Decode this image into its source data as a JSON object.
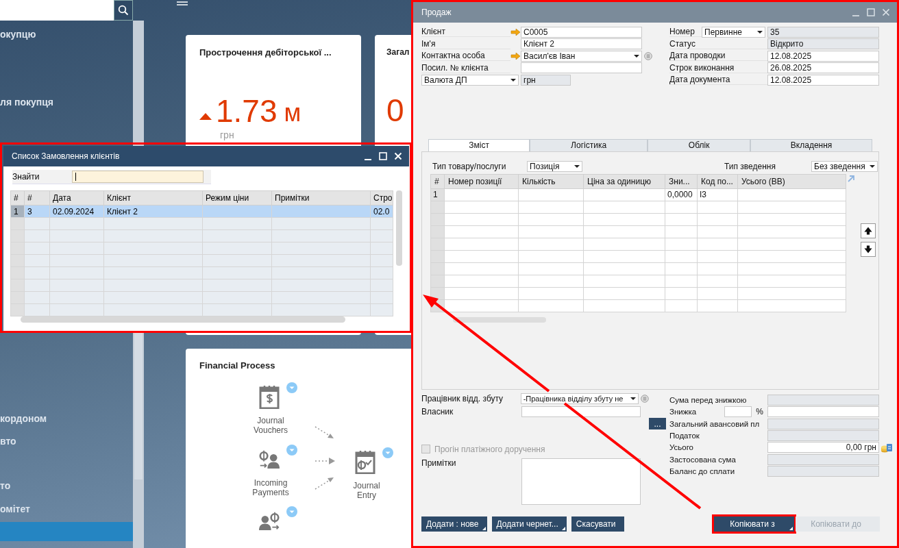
{
  "sidebar": {
    "items": [
      {
        "label": "окупцю",
        "selected": false
      },
      {
        "label": "ля покупця",
        "selected": false
      },
      {
        "label": "кордоном",
        "selected": false
      },
      {
        "label": "вто",
        "selected": false
      },
      {
        "label": "то",
        "selected": false
      },
      {
        "label": "омітет",
        "selected": false
      },
      {
        "selected": true
      }
    ]
  },
  "cards": [
    {
      "title": "Прострочення дебіторської ...",
      "value": "1.73",
      "unit": "м",
      "currency": "грн",
      "rising": true
    },
    {
      "title": "Загал",
      "value": "0"
    }
  ],
  "financial_process": {
    "title": "Financial Process",
    "nodes": [
      {
        "kind": "voucher",
        "label": "Journal Vouchers"
      },
      {
        "kind": "incoming",
        "label": "Incoming Payments"
      },
      {
        "kind": "entry",
        "label": "Journal Entry"
      },
      {
        "kind": "outgoing"
      }
    ]
  },
  "orders_window": {
    "title": "Список Замовлення клієнтів",
    "find_label": "Знайти",
    "columns": [
      "#",
      "#",
      "Дата",
      "Клієнт",
      "Режим ціни",
      "Примітки",
      "Стро"
    ],
    "rows": [
      {
        "cells": [
          "1",
          "3",
          "02.09.2024",
          "Клієнт 2",
          null,
          null,
          "02.0"
        ],
        "selected": true
      }
    ]
  },
  "sales_window": {
    "title": "Продаж",
    "left_fields": [
      {
        "kind": "link-input",
        "label": "Клієнт",
        "value": "C0005"
      },
      {
        "kind": "input",
        "label": "Ім'я",
        "value": "Клієнт 2"
      },
      {
        "kind": "link-dropdown",
        "label": "Контактна особа",
        "value": "Васил'єв Іван"
      },
      {
        "kind": "input",
        "label": "Посил. № клієнта"
      },
      {
        "kind": "currency",
        "label": "Валюта ДП",
        "value": "грн"
      }
    ],
    "right_fields": [
      {
        "kind": "series",
        "label": "Номер",
        "select": "Первинне",
        "value": "35",
        "readonly": true
      },
      {
        "kind": "field",
        "label": "Статус",
        "value": "Відкрито",
        "readonly": true
      },
      {
        "kind": "field",
        "label": "Дата проводки",
        "value": "12.08.2025",
        "readonly": false
      },
      {
        "kind": "field",
        "label": "Строк виконання",
        "value": "26.08.2025",
        "readonly": false
      },
      {
        "kind": "field",
        "label": "Дата документа",
        "value": "12.08.2025",
        "readonly": false
      }
    ],
    "tabs": [
      {
        "label": "Зміст",
        "selected": true
      },
      {
        "label": "Логістика",
        "selected": false
      },
      {
        "label": "Облік",
        "selected": false
      },
      {
        "label": "Вкладення",
        "selected": false
      }
    ],
    "item_type": {
      "label": "Тип товару/послуги",
      "value": "Позиція"
    },
    "summary_type": {
      "label": "Тип зведення",
      "value": "Без зведення"
    },
    "lines": {
      "columns": [
        "#",
        "Номер позиції",
        "Кількість",
        "Ціна за одиницю",
        "Зни...",
        "Код по...",
        "Усього (ВВ)"
      ],
      "rows": [
        {
          "cells": [
            "1",
            null,
            null,
            null,
            "0,0000",
            "I3",
            null
          ]
        }
      ]
    },
    "sales_employee": {
      "label": "Працівник відд. збуту",
      "value": "-Працівника відділу збуту не"
    },
    "owner": {
      "label": "Власник"
    },
    "payment_run": {
      "label": "Прогін платіжного доручення",
      "checked": false,
      "disabled": true
    },
    "remarks": {
      "label": "Примітки"
    },
    "totals": [
      {
        "kind": "readonly",
        "label": "Сума перед знижкою"
      },
      {
        "kind": "discount",
        "label": "Знижка",
        "percent": "%"
      },
      {
        "kind": "advance",
        "label": "Загальний авансовий пл",
        "button": "..."
      },
      {
        "kind": "readonly",
        "label": "Податок"
      },
      {
        "kind": "total",
        "label": "Усього",
        "value": "0,00 грн"
      },
      {
        "kind": "readonly",
        "label": "Застосована сума"
      },
      {
        "kind": "readonly",
        "label": "Баланс до сплати"
      }
    ],
    "buttons": [
      {
        "label": "Додати : нове",
        "kind": "split",
        "disabled": false,
        "highlighted": false
      },
      {
        "label": "Додати чернет...",
        "kind": "split",
        "disabled": false,
        "highlighted": false
      },
      {
        "label": "Скасувати",
        "kind": "plain",
        "disabled": false,
        "highlighted": false
      },
      {
        "label": "Копіювати з",
        "kind": "split",
        "disabled": false,
        "highlighted": true
      },
      {
        "label": "Копіювати до",
        "kind": "plain",
        "disabled": true,
        "highlighted": false
      }
    ]
  }
}
